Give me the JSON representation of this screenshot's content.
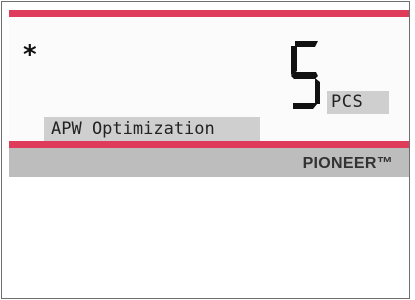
{
  "display": {
    "asterisk": "*",
    "weight_value": "5",
    "unit": "PCS",
    "message": "APW Optimization",
    "brand": "PIONEER™"
  },
  "colors": {
    "accent_red": "#de3c5a",
    "panel_gray": "#bdbdbd",
    "label_gray": "#cfcfcf"
  }
}
